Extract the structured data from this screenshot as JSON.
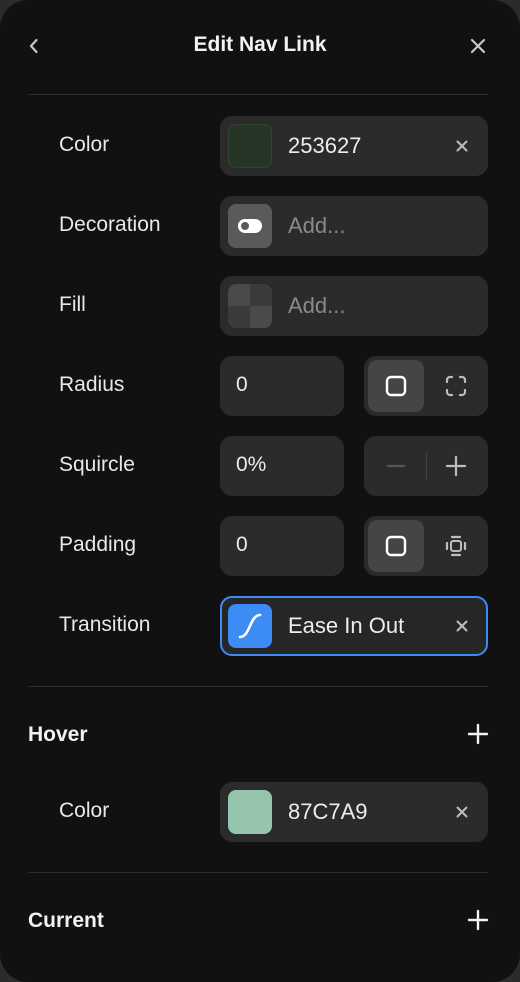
{
  "header": {
    "title": "Edit Nav Link",
    "back_icon": "chevron-left-icon",
    "close_icon": "close-icon"
  },
  "properties": {
    "color": {
      "label": "Color",
      "value": "253627",
      "swatch": "#253627"
    },
    "decoration": {
      "label": "Decoration",
      "placeholder": "Add..."
    },
    "fill": {
      "label": "Fill",
      "placeholder": "Add..."
    },
    "radius": {
      "label": "Radius",
      "value": "0"
    },
    "squircle": {
      "label": "Squircle",
      "value": "0%"
    },
    "padding": {
      "label": "Padding",
      "value": "0"
    },
    "transition": {
      "label": "Transition",
      "value": "Ease In Out",
      "accent": "#3d8bf5"
    }
  },
  "hover": {
    "title": "Hover",
    "color": {
      "label": "Color",
      "value": "87C7A9",
      "swatch": "#95c6ad"
    }
  },
  "current": {
    "title": "Current"
  }
}
